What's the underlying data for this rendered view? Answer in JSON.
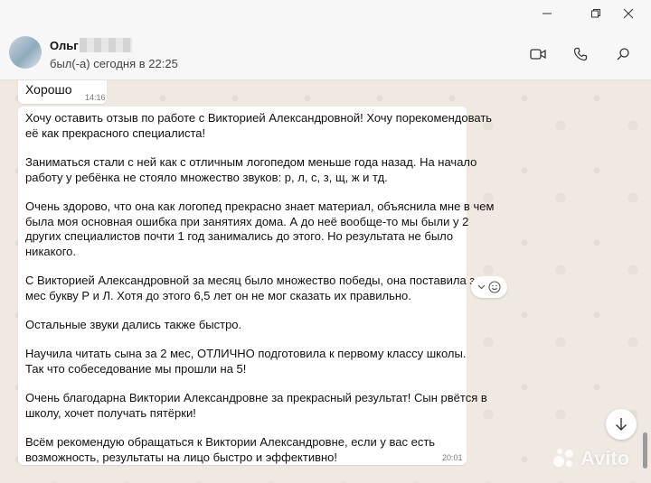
{
  "window": {
    "minimize_icon": "minimize-icon",
    "maximize_icon": "restore-icon",
    "close_icon": "close-icon"
  },
  "header": {
    "contact_name": "Ольг",
    "status": "был(-а) сегодня в 22:25",
    "video_call_icon": "video-camera-icon",
    "voice_call_icon": "phone-icon",
    "search_icon": "search-icon"
  },
  "messages": [
    {
      "text": "Хорошо",
      "time": "14:16"
    },
    {
      "paragraphs": [
        [
          "Хочу оставить отзыв по работе с Викторией Александровной! Хочу порекомендовать",
          "её как прекрасного специалиста!"
        ],
        [
          "Заниматься стали с ней как с отличным логопедом меньше года назад. На начало",
          "работу у ребёнка не стояло множество звуков: р, л, с, з, щ, ж и тд."
        ],
        [
          "Очень здорово, что она как логопед прекрасно знает материал, объяснила мне в чем",
          "была моя основная ошибка при занятиях дома. А до неё вообще-то мы были у 2",
          "других специалистов почти 1 год занимались до этого. Но результата не было",
          "никакого."
        ],
        [
          "С Викторией Александровной за месяц было множество победы, она поставила за 2",
          "мес букву Р и Л. Хотя до этого 6,5 лет он не мог сказать их правильно."
        ],
        [
          "Остальные звуки дались также быстро."
        ],
        [
          "Научила читать сына за 2 мес, ОТЛИЧНО подготовила к первому классу школы.",
          "Так что собеседование мы прошли на 5!"
        ],
        [
          "Очень благодарна Виктории Александровне за прекрасный результат! Сын рвётся в",
          "школу, хочет получать пятёрки!"
        ],
        [
          "Всём рекомендую обращаться к Виктории Александровне, если у вас есть",
          "возможность, результаты на лицо быстро и эффективно!"
        ]
      ],
      "time": "20:01"
    }
  ],
  "reaction_button_icons": [
    "chevron-down-icon",
    "smiley-icon"
  ],
  "scroll_down_icon": "arrow-down-icon",
  "watermark": "Avito",
  "colors": {
    "chat_bg": "#efe9e2",
    "bubble": "#ffffff",
    "header_bg": "#f7f7f7"
  }
}
